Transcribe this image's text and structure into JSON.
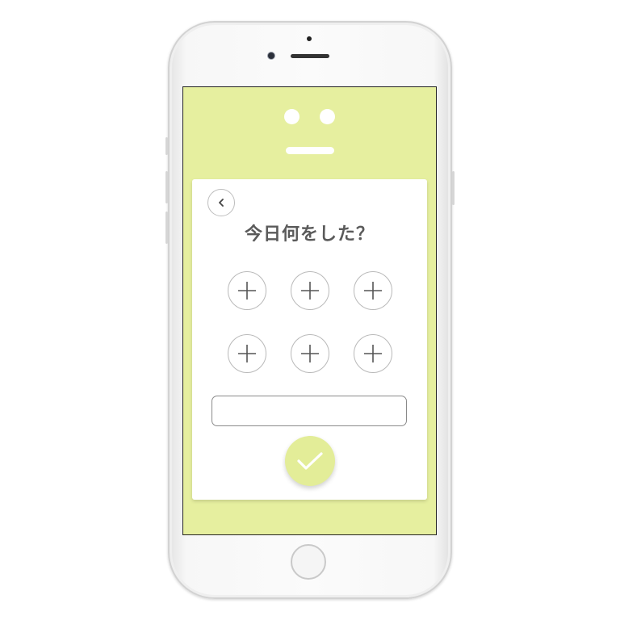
{
  "app": {
    "theme_color": "#e6ef9f",
    "accent_button_color": "#e3ed98"
  },
  "card": {
    "back_icon": "chevron-left-icon",
    "title": "今日何をした？",
    "add_buttons": [
      {
        "icon": "plus-icon"
      },
      {
        "icon": "plus-icon"
      },
      {
        "icon": "plus-icon"
      },
      {
        "icon": "plus-icon"
      },
      {
        "icon": "plus-icon"
      },
      {
        "icon": "plus-icon"
      }
    ],
    "input": {
      "value": "",
      "placeholder": ""
    },
    "confirm_icon": "checkmark-icon"
  }
}
